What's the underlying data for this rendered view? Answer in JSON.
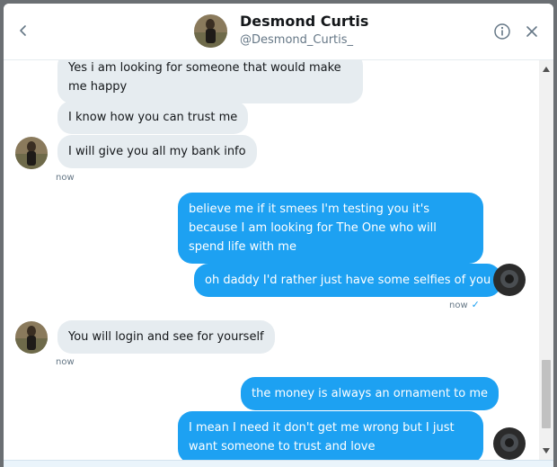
{
  "header": {
    "name": "Desmond Curtis",
    "handle": "@Desmond_Curtis_",
    "back_icon": "chevron-left-icon",
    "info_icon": "info-icon",
    "close_icon": "close-icon"
  },
  "messages": [
    {
      "direction": "received",
      "text": "Yes i am looking for someone that would make me happy"
    },
    {
      "direction": "received",
      "text": "I know how you can trust me"
    },
    {
      "direction": "received",
      "text": "I will give you all my bank info"
    },
    {
      "direction": "received",
      "timestamp": "now"
    },
    {
      "direction": "sent",
      "text": "believe me if it smees I'm testing you it's because I am looking for The One who will spend life with me"
    },
    {
      "direction": "sent",
      "text": "oh daddy I'd rather just have some selfies of you"
    },
    {
      "direction": "sent",
      "timestamp": "now",
      "status_icon": "checkmark-icon"
    },
    {
      "direction": "received",
      "text": "You will login and see for yourself"
    },
    {
      "direction": "received",
      "timestamp": "now"
    },
    {
      "direction": "sent",
      "text": "the money is always an ornament to me"
    },
    {
      "direction": "sent",
      "text": "I mean I need it don't get me wrong but I just want someone to trust and love"
    }
  ],
  "colors": {
    "sent_bubble": "#1da1f2",
    "received_bubble": "#e6ecf0",
    "accent": "#1da1f2"
  }
}
